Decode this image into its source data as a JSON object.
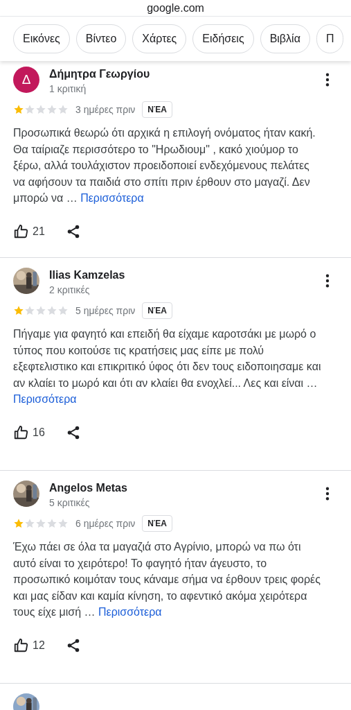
{
  "address_bar": {
    "domain": "google.com"
  },
  "chips": [
    {
      "label": "Εικόνες"
    },
    {
      "label": "Βίντεο"
    },
    {
      "label": "Χάρτες"
    },
    {
      "label": "Ειδήσεις"
    },
    {
      "label": "Βιβλία"
    },
    {
      "label": "Π"
    }
  ],
  "reviews": [
    {
      "avatar": {
        "kind": "letter",
        "letter": "Δ",
        "color": "#c2185b"
      },
      "name": "Δήμητρα Γεωργίου",
      "count": "1 κριτική",
      "stars": 1,
      "time": "3 ημέρες πριν",
      "badge": "ΝΈΑ",
      "text": "Προσωπικά θεωρώ ότι αρχικά η επιλογή ονόματος ήταν κακή. Θα ταίριαζε περισσότερο το \"Ηρωδιουμ\" , κακό χιούμορ το ξέρω, αλλά τουλάχιστον προειδοποιεί ενδεχόμενους πελάτες να αφήσουν τα παιδιά στο σπίτι πριν έρθουν στο μαγαζί. Δεν μπορώ να …",
      "more": "Περισσότερα",
      "likes": "21"
    },
    {
      "name": "Ilias Kamzelas",
      "count": "2 κριτικές",
      "stars": 1,
      "time": "5 ημέρες πριν",
      "badge": "ΝΈΑ",
      "text": "Πήγαμε για φαγητό και επειδή θα είχαμε καροτσάκι με μωρό ο τύπος που κοιτούσε τις κρατήσεις μας είπε με πολύ εξεφτελιστικο και επικριτικό ύφος ότι δεν τους ειδοποιησαμε και αν κλαίει το μωρό και ότι αν κλαίει θα ενοχλεί... Λες και είναι …",
      "more": "Περισσότερα",
      "likes": "16"
    },
    {
      "name": "Angelos Metas",
      "count": "5 κριτικές",
      "stars": 1,
      "time": "6 ημέρες πριν",
      "badge": "ΝΈΑ",
      "text": "Έχω πάει σε όλα τα μαγαζιά στο Αγρίνιο, μπορώ να πω ότι αυτό είναι το χειρότερο! Το φαγητό ήταν άγευστο, το προσωπικό κοιμόταν τους κάναμε σήμα να έρθουν τρεις φορές και μας είδαν και καμία κίνηση, το αφεντικό ακόμα χειρότερα τους είχε μισή …",
      "more": "Περισσότερα",
      "likes": "12"
    }
  ]
}
